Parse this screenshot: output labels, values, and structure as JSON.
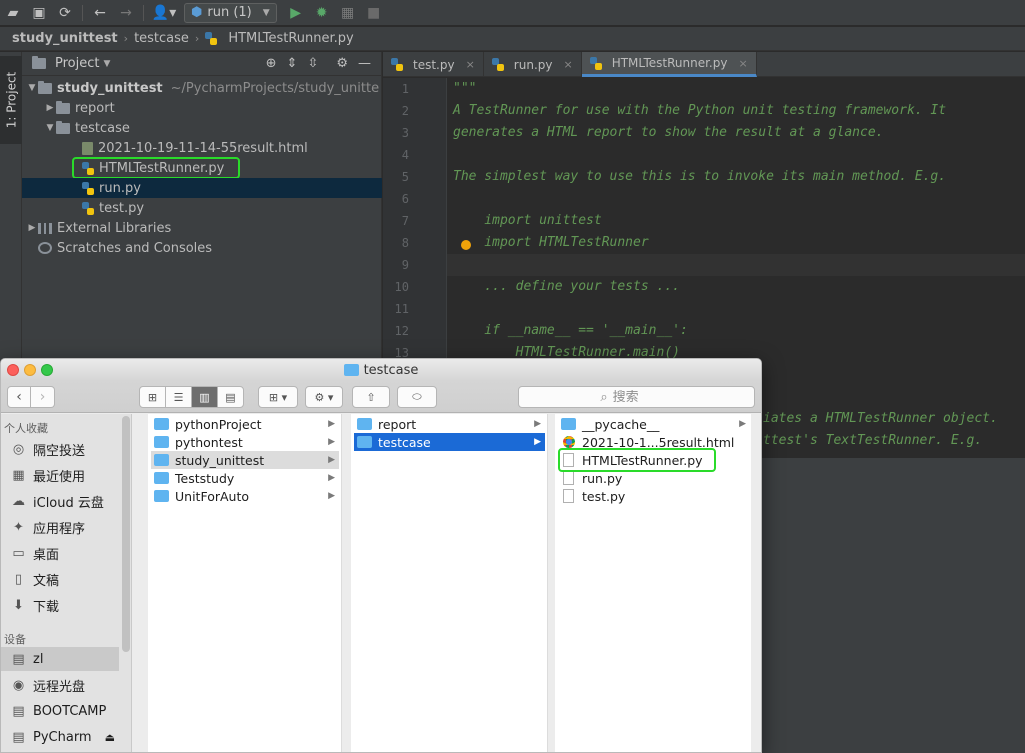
{
  "toolbar": {
    "run_config": "run (1)"
  },
  "breadcrumb": [
    "study_unittest",
    "testcase",
    "HTMLTestRunner.py"
  ],
  "left_strip": {
    "tab_label": "1: Project"
  },
  "project": {
    "title": "Project",
    "root_name": "study_unittest",
    "root_path": "~/PycharmProjects/study_unitte",
    "items": [
      {
        "label": "report"
      },
      {
        "label": "testcase"
      },
      {
        "label": "2021-10-19-11-14-55result.html"
      },
      {
        "label": "HTMLTestRunner.py"
      },
      {
        "label": "run.py"
      },
      {
        "label": "test.py"
      },
      {
        "label": "External Libraries"
      },
      {
        "label": "Scratches and Consoles"
      }
    ]
  },
  "editor": {
    "tabs": [
      {
        "label": "test.py"
      },
      {
        "label": "run.py"
      },
      {
        "label": "HTMLTestRunner.py"
      }
    ],
    "line_numbers": [
      "1",
      "2",
      "3",
      "4",
      "5",
      "6",
      "7",
      "8",
      "9",
      "10",
      "11",
      "12",
      "13"
    ],
    "lines": [
      "\"\"\"",
      "A TestRunner for use with the Python unit testing framework. It",
      "generates a HTML report to show the result at a glance.",
      "",
      "The simplest way to use this is to invoke its main method. E.g.",
      "",
      "    import unittest",
      "    import HTMLTestRunner",
      "",
      "    ... define your tests ...",
      "",
      "    if __name__ == '__main__':",
      "        HTMLTestRunner.main()"
    ],
    "visible_tail": [
      "iates a HTMLTestRunner object.",
      "ttest's TextTestRunner. E.g."
    ]
  },
  "finder": {
    "title": "testcase",
    "search_placeholder": "搜索",
    "sidebar": {
      "favorites_header": "个人收藏",
      "favorites": [
        {
          "label": "隔空投送",
          "icon": "airdrop-icon"
        },
        {
          "label": "最近使用",
          "icon": "recents-icon"
        },
        {
          "label": "iCloud 云盘",
          "icon": "icloud-icon"
        },
        {
          "label": "应用程序",
          "icon": "applications-icon"
        },
        {
          "label": "桌面",
          "icon": "desktop-icon"
        },
        {
          "label": "文稿",
          "icon": "documents-icon"
        },
        {
          "label": "下载",
          "icon": "downloads-icon"
        }
      ],
      "devices_header": "设备",
      "devices": [
        {
          "label": "zl",
          "icon": "disk-icon"
        },
        {
          "label": "远程光盘",
          "icon": "remote-disc-icon"
        },
        {
          "label": "BOOTCAMP",
          "icon": "disk-icon"
        },
        {
          "label": "PyCharm",
          "icon": "disk-icon"
        }
      ]
    },
    "columns": [
      [
        "pythonProject",
        "pythontest",
        "study_unittest",
        "Teststudy",
        "UnitForAuto"
      ],
      [
        "report",
        "testcase"
      ],
      [
        "__pycache__",
        "2021-10-1...5result.html",
        "HTMLTestRunner.py",
        "run.py",
        "test.py"
      ]
    ]
  }
}
